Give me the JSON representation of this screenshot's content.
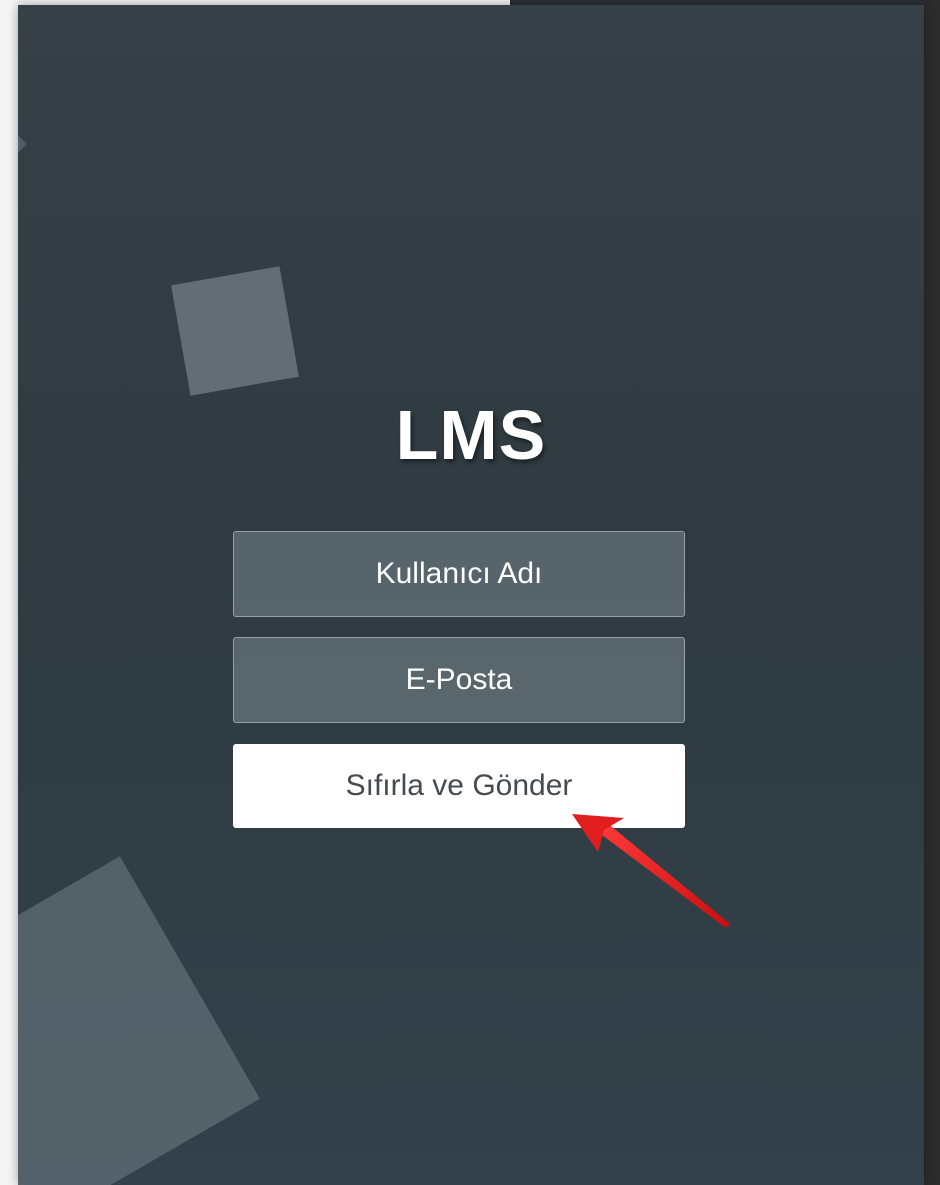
{
  "app": {
    "title": "LMS"
  },
  "form": {
    "username_placeholder": "Kullanıcı Adı",
    "email_placeholder": "E-Posta",
    "submit_label": "Sıfırla ve Gönder"
  },
  "colors": {
    "background": "#2f3a41",
    "input_fill": "#5f6a71",
    "button_fill": "#ffffff",
    "button_text": "#444c52",
    "annotation_arrow": "#e01e1e"
  },
  "annotation": {
    "icon": "red-arrow-icon",
    "target": "submit-button"
  }
}
